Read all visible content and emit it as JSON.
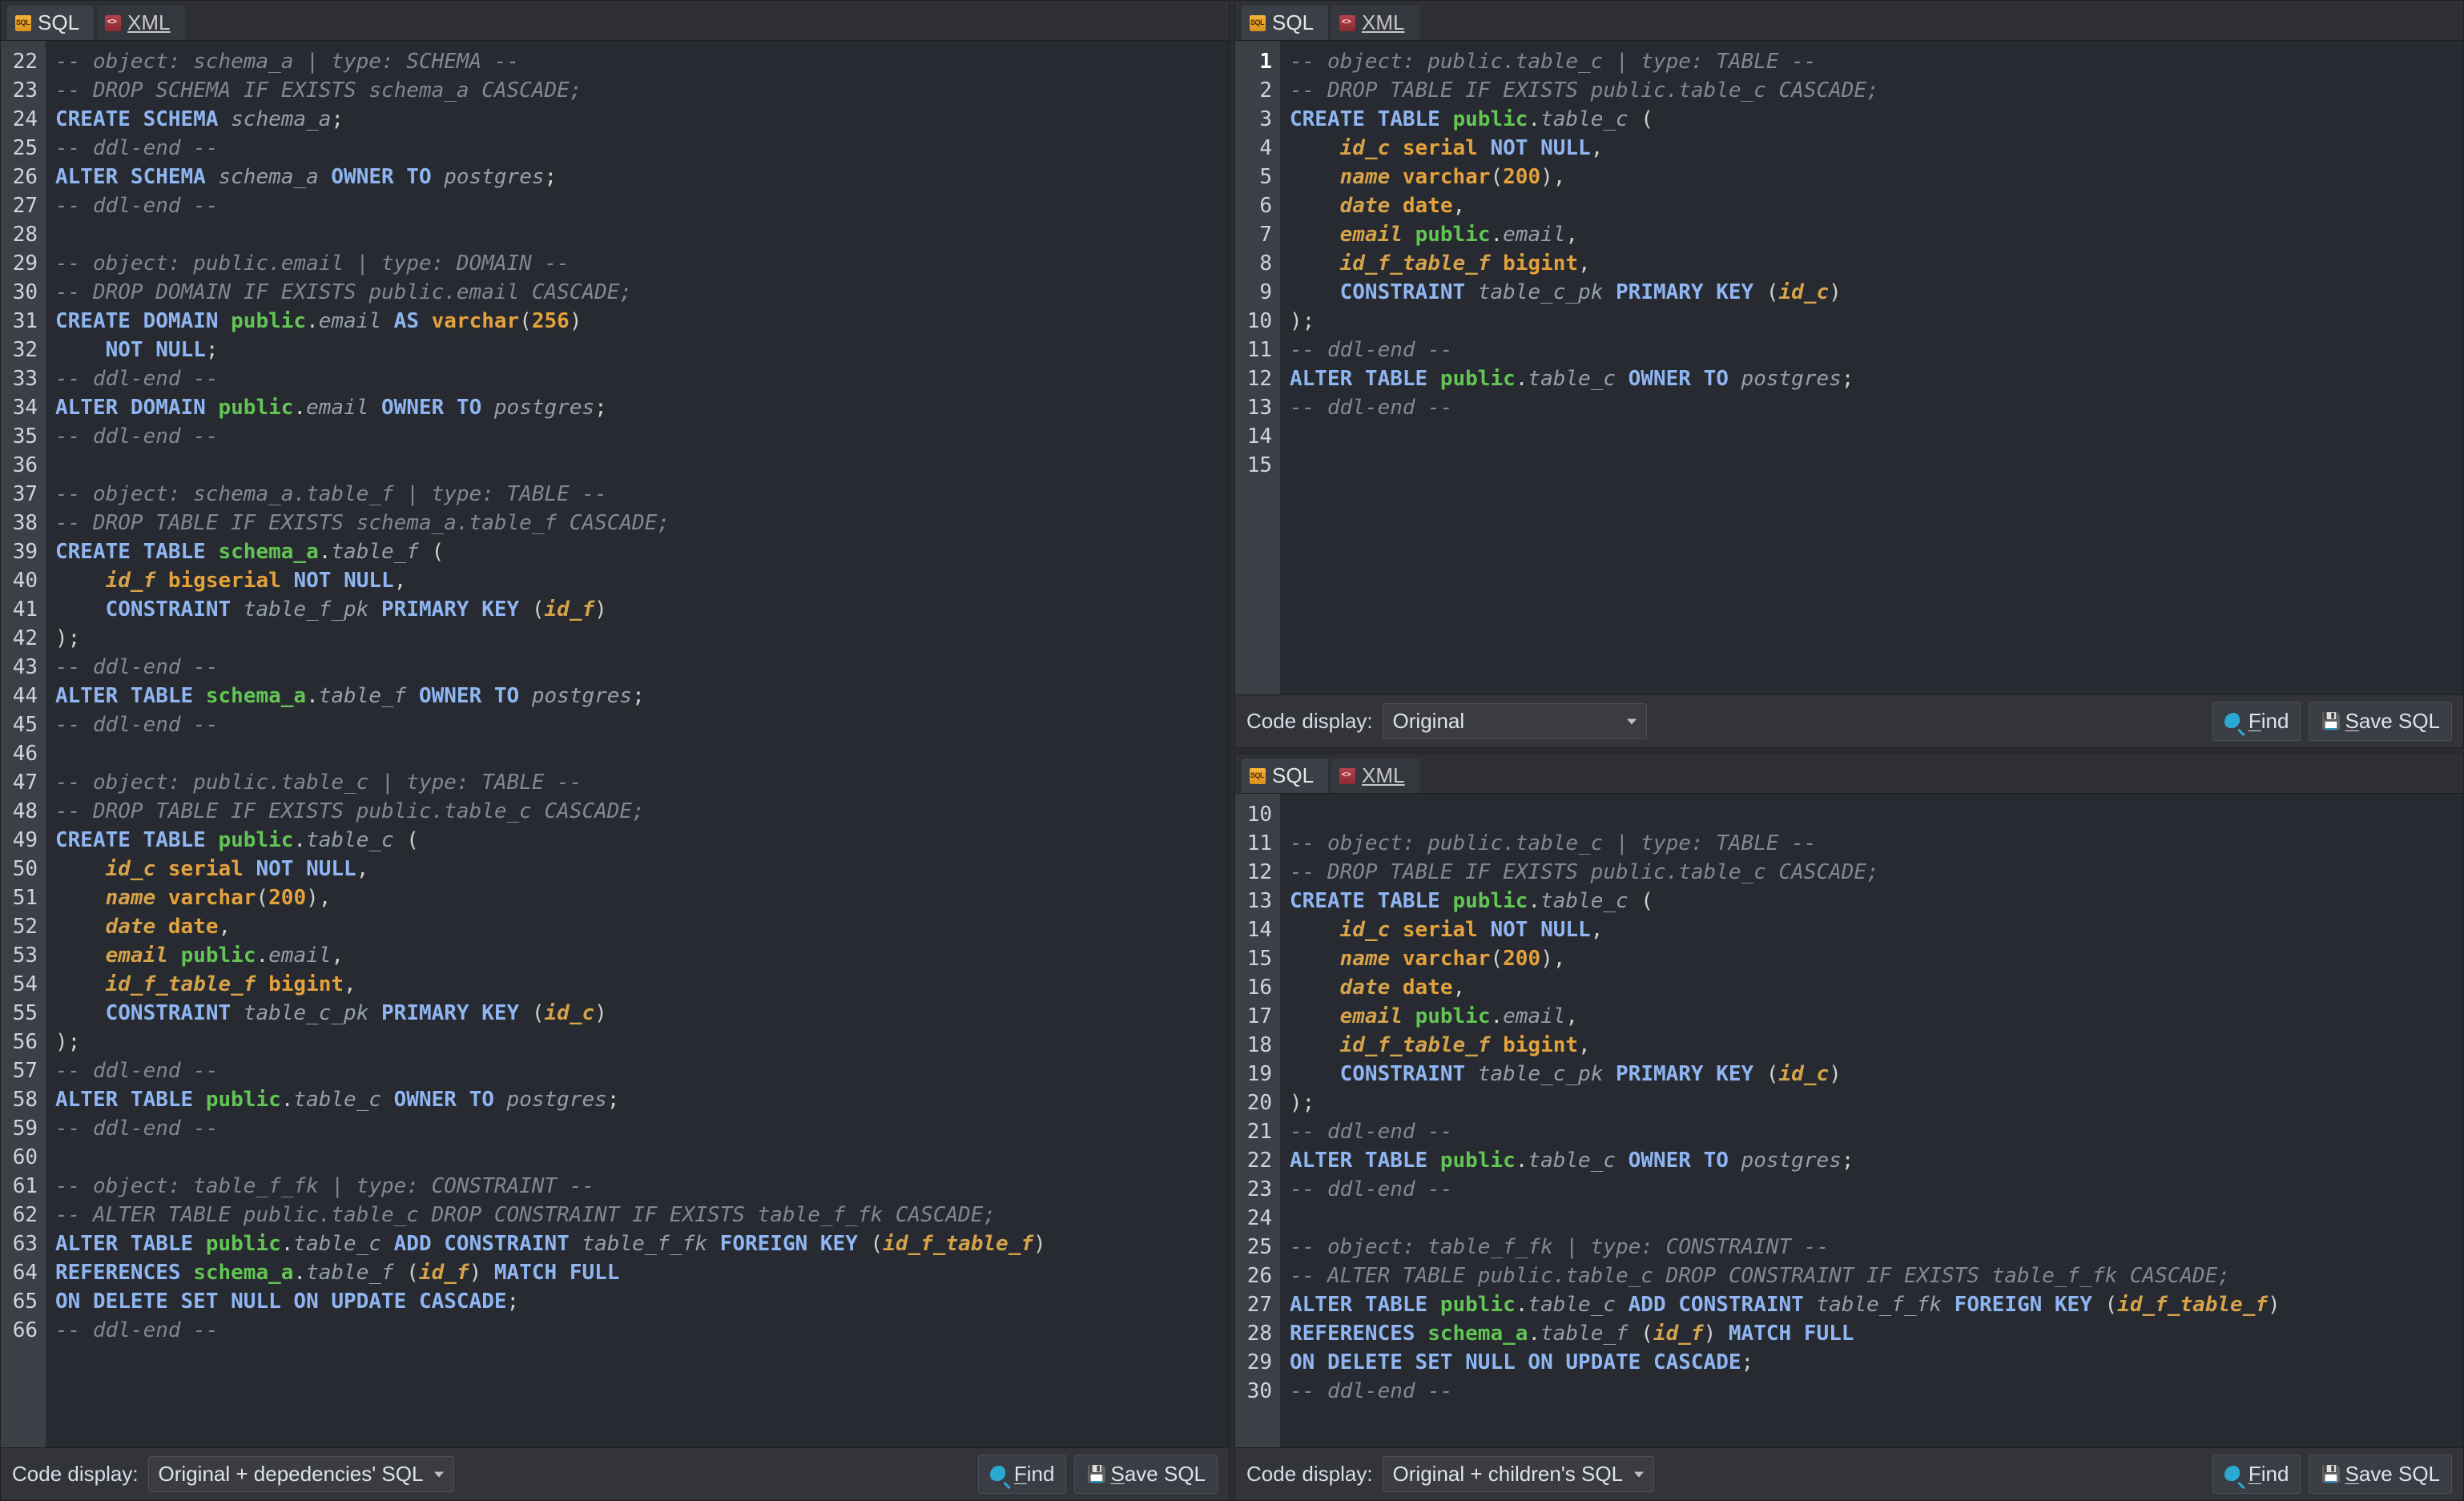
{
  "tabs": {
    "sql": "SQL",
    "xml": "XML"
  },
  "footer": {
    "label": "Code display:",
    "find": "Find",
    "save": "Save SQL",
    "find_u": "F",
    "save_u": "S"
  },
  "selects": {
    "p1": "Original",
    "p2": "Original + children's SQL",
    "p3": "Original + depedencies' SQL"
  },
  "p1": {
    "start": 1,
    "lines": [
      [
        [
          "cm",
          "-- object: public.table_c | type: TABLE --"
        ]
      ],
      [
        [
          "cm",
          "-- DROP TABLE IF EXISTS public.table_c CASCADE;"
        ]
      ],
      [
        [
          "kw",
          "CREATE TABLE "
        ],
        [
          "id-green",
          "public"
        ],
        [
          "par",
          "."
        ],
        [
          "id-ital",
          "table_c"
        ],
        [
          "par",
          " ("
        ]
      ],
      [
        [
          "par",
          "    "
        ],
        [
          "col",
          "id_c"
        ],
        [
          "par",
          " "
        ],
        [
          "typ",
          "serial"
        ],
        [
          "par",
          " "
        ],
        [
          "kw",
          "NOT NULL"
        ],
        [
          "par",
          ","
        ]
      ],
      [
        [
          "par",
          "    "
        ],
        [
          "col",
          "name"
        ],
        [
          "par",
          " "
        ],
        [
          "typ",
          "varchar"
        ],
        [
          "par",
          "("
        ],
        [
          "num",
          "200"
        ],
        [
          "par",
          "),"
        ]
      ],
      [
        [
          "par",
          "    "
        ],
        [
          "col",
          "date"
        ],
        [
          "par",
          " "
        ],
        [
          "typ",
          "date"
        ],
        [
          "par",
          ","
        ]
      ],
      [
        [
          "par",
          "    "
        ],
        [
          "col",
          "email"
        ],
        [
          "par",
          " "
        ],
        [
          "id-green",
          "public"
        ],
        [
          "par",
          "."
        ],
        [
          "id-ital",
          "email"
        ],
        [
          "par",
          ","
        ]
      ],
      [
        [
          "par",
          "    "
        ],
        [
          "col",
          "id_f_table_f"
        ],
        [
          "par",
          " "
        ],
        [
          "typ",
          "bigint"
        ],
        [
          "par",
          ","
        ]
      ],
      [
        [
          "par",
          "    "
        ],
        [
          "kw",
          "CONSTRAINT "
        ],
        [
          "id-ital",
          "table_c_pk"
        ],
        [
          "par",
          " "
        ],
        [
          "kw",
          "PRIMARY KEY"
        ],
        [
          "par",
          " ("
        ],
        [
          "col",
          "id_c"
        ],
        [
          "par",
          ")"
        ]
      ],
      [
        [
          "par",
          ");"
        ]
      ],
      [
        [
          "cm",
          "-- ddl-end --"
        ]
      ],
      [
        [
          "kw",
          "ALTER TABLE "
        ],
        [
          "id-green",
          "public"
        ],
        [
          "par",
          "."
        ],
        [
          "id-ital",
          "table_c"
        ],
        [
          "par",
          " "
        ],
        [
          "kw",
          "OWNER TO"
        ],
        [
          "par",
          " "
        ],
        [
          "id-ital",
          "postgres"
        ],
        [
          "par",
          ";"
        ]
      ],
      [
        [
          "cm",
          "-- ddl-end --"
        ]
      ],
      [
        [
          "par",
          ""
        ]
      ],
      [
        [
          "par",
          ""
        ]
      ]
    ]
  },
  "p2": {
    "start": 10,
    "lines": [
      [
        [
          "par",
          ""
        ]
      ],
      [
        [
          "cm",
          "-- object: public.table_c | type: TABLE --"
        ]
      ],
      [
        [
          "cm",
          "-- DROP TABLE IF EXISTS public.table_c CASCADE;"
        ]
      ],
      [
        [
          "kw",
          "CREATE TABLE "
        ],
        [
          "id-green",
          "public"
        ],
        [
          "par",
          "."
        ],
        [
          "id-ital",
          "table_c"
        ],
        [
          "par",
          " ("
        ]
      ],
      [
        [
          "par",
          "    "
        ],
        [
          "col",
          "id_c"
        ],
        [
          "par",
          " "
        ],
        [
          "typ",
          "serial"
        ],
        [
          "par",
          " "
        ],
        [
          "kw",
          "NOT NULL"
        ],
        [
          "par",
          ","
        ]
      ],
      [
        [
          "par",
          "    "
        ],
        [
          "col",
          "name"
        ],
        [
          "par",
          " "
        ],
        [
          "typ",
          "varchar"
        ],
        [
          "par",
          "("
        ],
        [
          "num",
          "200"
        ],
        [
          "par",
          "),"
        ]
      ],
      [
        [
          "par",
          "    "
        ],
        [
          "col",
          "date"
        ],
        [
          "par",
          " "
        ],
        [
          "typ",
          "date"
        ],
        [
          "par",
          ","
        ]
      ],
      [
        [
          "par",
          "    "
        ],
        [
          "col",
          "email"
        ],
        [
          "par",
          " "
        ],
        [
          "id-green",
          "public"
        ],
        [
          "par",
          "."
        ],
        [
          "id-ital",
          "email"
        ],
        [
          "par",
          ","
        ]
      ],
      [
        [
          "par",
          "    "
        ],
        [
          "col",
          "id_f_table_f"
        ],
        [
          "par",
          " "
        ],
        [
          "typ",
          "bigint"
        ],
        [
          "par",
          ","
        ]
      ],
      [
        [
          "par",
          "    "
        ],
        [
          "kw",
          "CONSTRAINT "
        ],
        [
          "id-ital",
          "table_c_pk"
        ],
        [
          "par",
          " "
        ],
        [
          "kw",
          "PRIMARY KEY"
        ],
        [
          "par",
          " ("
        ],
        [
          "col",
          "id_c"
        ],
        [
          "par",
          ")"
        ]
      ],
      [
        [
          "par",
          ");"
        ]
      ],
      [
        [
          "cm",
          "-- ddl-end --"
        ]
      ],
      [
        [
          "kw",
          "ALTER TABLE "
        ],
        [
          "id-green",
          "public"
        ],
        [
          "par",
          "."
        ],
        [
          "id-ital",
          "table_c"
        ],
        [
          "par",
          " "
        ],
        [
          "kw",
          "OWNER TO"
        ],
        [
          "par",
          " "
        ],
        [
          "id-ital",
          "postgres"
        ],
        [
          "par",
          ";"
        ]
      ],
      [
        [
          "cm",
          "-- ddl-end --"
        ]
      ],
      [
        [
          "par",
          ""
        ]
      ],
      [
        [
          "cm",
          "-- object: table_f_fk | type: CONSTRAINT --"
        ]
      ],
      [
        [
          "cm",
          "-- ALTER TABLE public.table_c DROP CONSTRAINT IF EXISTS table_f_fk CASCADE;"
        ]
      ],
      [
        [
          "kw",
          "ALTER TABLE "
        ],
        [
          "id-green",
          "public"
        ],
        [
          "par",
          "."
        ],
        [
          "id-ital",
          "table_c"
        ],
        [
          "par",
          " "
        ],
        [
          "kw",
          "ADD CONSTRAINT "
        ],
        [
          "id-ital",
          "table_f_fk"
        ],
        [
          "par",
          " "
        ],
        [
          "kw",
          "FOREIGN KEY"
        ],
        [
          "par",
          " ("
        ],
        [
          "col",
          "id_f_table_f"
        ],
        [
          "par",
          ")"
        ]
      ],
      [
        [
          "kw",
          "REFERENCES "
        ],
        [
          "id-green",
          "schema_a"
        ],
        [
          "par",
          "."
        ],
        [
          "id-ital",
          "table_f"
        ],
        [
          "par",
          " ("
        ],
        [
          "col",
          "id_f"
        ],
        [
          "par",
          ") "
        ],
        [
          "kw",
          "MATCH FULL"
        ]
      ],
      [
        [
          "kw",
          "ON DELETE SET NULL ON UPDATE CASCADE"
        ],
        [
          "par",
          ";"
        ]
      ],
      [
        [
          "cm",
          "-- ddl-end --"
        ]
      ]
    ]
  },
  "p3": {
    "start": 22,
    "lines": [
      [
        [
          "cm",
          "-- object: schema_a | type: SCHEMA --"
        ]
      ],
      [
        [
          "cm",
          "-- DROP SCHEMA IF EXISTS schema_a CASCADE;"
        ]
      ],
      [
        [
          "kw",
          "CREATE SCHEMA "
        ],
        [
          "id-ital",
          "schema_a"
        ],
        [
          "par",
          ";"
        ]
      ],
      [
        [
          "cm",
          "-- ddl-end --"
        ]
      ],
      [
        [
          "kw",
          "ALTER SCHEMA "
        ],
        [
          "id-ital",
          "schema_a"
        ],
        [
          "par",
          " "
        ],
        [
          "kw",
          "OWNER TO"
        ],
        [
          "par",
          " "
        ],
        [
          "id-ital",
          "postgres"
        ],
        [
          "par",
          ";"
        ]
      ],
      [
        [
          "cm",
          "-- ddl-end --"
        ]
      ],
      [
        [
          "par",
          ""
        ]
      ],
      [
        [
          "cm",
          "-- object: public.email | type: DOMAIN --"
        ]
      ],
      [
        [
          "cm",
          "-- DROP DOMAIN IF EXISTS public.email CASCADE;"
        ]
      ],
      [
        [
          "kw",
          "CREATE DOMAIN "
        ],
        [
          "id-green",
          "public"
        ],
        [
          "par",
          "."
        ],
        [
          "id-ital",
          "email"
        ],
        [
          "par",
          " "
        ],
        [
          "kw",
          "AS "
        ],
        [
          "typ",
          "varchar"
        ],
        [
          "par",
          "("
        ],
        [
          "num",
          "256"
        ],
        [
          "par",
          ")"
        ]
      ],
      [
        [
          "par",
          "    "
        ],
        [
          "kw",
          "NOT NULL"
        ],
        [
          "par",
          ";"
        ]
      ],
      [
        [
          "cm",
          "-- ddl-end --"
        ]
      ],
      [
        [
          "kw",
          "ALTER DOMAIN "
        ],
        [
          "id-green",
          "public"
        ],
        [
          "par",
          "."
        ],
        [
          "id-ital",
          "email"
        ],
        [
          "par",
          " "
        ],
        [
          "kw",
          "OWNER TO"
        ],
        [
          "par",
          " "
        ],
        [
          "id-ital",
          "postgres"
        ],
        [
          "par",
          ";"
        ]
      ],
      [
        [
          "cm",
          "-- ddl-end --"
        ]
      ],
      [
        [
          "par",
          ""
        ]
      ],
      [
        [
          "cm",
          "-- object: schema_a.table_f | type: TABLE --"
        ]
      ],
      [
        [
          "cm",
          "-- DROP TABLE IF EXISTS schema_a.table_f CASCADE;"
        ]
      ],
      [
        [
          "kw",
          "CREATE TABLE "
        ],
        [
          "id-green",
          "schema_a"
        ],
        [
          "par",
          "."
        ],
        [
          "id-ital",
          "table_f"
        ],
        [
          "par",
          " ("
        ]
      ],
      [
        [
          "par",
          "    "
        ],
        [
          "col",
          "id_f"
        ],
        [
          "par",
          " "
        ],
        [
          "typ",
          "bigserial"
        ],
        [
          "par",
          " "
        ],
        [
          "kw",
          "NOT NULL"
        ],
        [
          "par",
          ","
        ]
      ],
      [
        [
          "par",
          "    "
        ],
        [
          "kw",
          "CONSTRAINT "
        ],
        [
          "id-ital",
          "table_f_pk"
        ],
        [
          "par",
          " "
        ],
        [
          "kw",
          "PRIMARY KEY"
        ],
        [
          "par",
          " ("
        ],
        [
          "col",
          "id_f"
        ],
        [
          "par",
          ")"
        ]
      ],
      [
        [
          "par",
          ");"
        ]
      ],
      [
        [
          "cm",
          "-- ddl-end --"
        ]
      ],
      [
        [
          "kw",
          "ALTER TABLE "
        ],
        [
          "id-green",
          "schema_a"
        ],
        [
          "par",
          "."
        ],
        [
          "id-ital",
          "table_f"
        ],
        [
          "par",
          " "
        ],
        [
          "kw",
          "OWNER TO"
        ],
        [
          "par",
          " "
        ],
        [
          "id-ital",
          "postgres"
        ],
        [
          "par",
          ";"
        ]
      ],
      [
        [
          "cm",
          "-- ddl-end --"
        ]
      ],
      [
        [
          "par",
          ""
        ]
      ],
      [
        [
          "cm",
          "-- object: public.table_c | type: TABLE --"
        ]
      ],
      [
        [
          "cm",
          "-- DROP TABLE IF EXISTS public.table_c CASCADE;"
        ]
      ],
      [
        [
          "kw",
          "CREATE TABLE "
        ],
        [
          "id-green",
          "public"
        ],
        [
          "par",
          "."
        ],
        [
          "id-ital",
          "table_c"
        ],
        [
          "par",
          " ("
        ]
      ],
      [
        [
          "par",
          "    "
        ],
        [
          "col",
          "id_c"
        ],
        [
          "par",
          " "
        ],
        [
          "typ",
          "serial"
        ],
        [
          "par",
          " "
        ],
        [
          "kw",
          "NOT NULL"
        ],
        [
          "par",
          ","
        ]
      ],
      [
        [
          "par",
          "    "
        ],
        [
          "col",
          "name"
        ],
        [
          "par",
          " "
        ],
        [
          "typ",
          "varchar"
        ],
        [
          "par",
          "("
        ],
        [
          "num",
          "200"
        ],
        [
          "par",
          "),"
        ]
      ],
      [
        [
          "par",
          "    "
        ],
        [
          "col",
          "date"
        ],
        [
          "par",
          " "
        ],
        [
          "typ",
          "date"
        ],
        [
          "par",
          ","
        ]
      ],
      [
        [
          "par",
          "    "
        ],
        [
          "col",
          "email"
        ],
        [
          "par",
          " "
        ],
        [
          "id-green",
          "public"
        ],
        [
          "par",
          "."
        ],
        [
          "id-ital",
          "email"
        ],
        [
          "par",
          ","
        ]
      ],
      [
        [
          "par",
          "    "
        ],
        [
          "col",
          "id_f_table_f"
        ],
        [
          "par",
          " "
        ],
        [
          "typ",
          "bigint"
        ],
        [
          "par",
          ","
        ]
      ],
      [
        [
          "par",
          "    "
        ],
        [
          "kw",
          "CONSTRAINT "
        ],
        [
          "id-ital",
          "table_c_pk"
        ],
        [
          "par",
          " "
        ],
        [
          "kw",
          "PRIMARY KEY"
        ],
        [
          "par",
          " ("
        ],
        [
          "col",
          "id_c"
        ],
        [
          "par",
          ")"
        ]
      ],
      [
        [
          "par",
          ");"
        ]
      ],
      [
        [
          "cm",
          "-- ddl-end --"
        ]
      ],
      [
        [
          "kw",
          "ALTER TABLE "
        ],
        [
          "id-green",
          "public"
        ],
        [
          "par",
          "."
        ],
        [
          "id-ital",
          "table_c"
        ],
        [
          "par",
          " "
        ],
        [
          "kw",
          "OWNER TO"
        ],
        [
          "par",
          " "
        ],
        [
          "id-ital",
          "postgres"
        ],
        [
          "par",
          ";"
        ]
      ],
      [
        [
          "cm",
          "-- ddl-end --"
        ]
      ],
      [
        [
          "par",
          ""
        ]
      ],
      [
        [
          "cm",
          "-- object: table_f_fk | type: CONSTRAINT --"
        ]
      ],
      [
        [
          "cm",
          "-- ALTER TABLE public.table_c DROP CONSTRAINT IF EXISTS table_f_fk CASCADE;"
        ]
      ],
      [
        [
          "kw",
          "ALTER TABLE "
        ],
        [
          "id-green",
          "public"
        ],
        [
          "par",
          "."
        ],
        [
          "id-ital",
          "table_c"
        ],
        [
          "par",
          " "
        ],
        [
          "kw",
          "ADD CONSTRAINT "
        ],
        [
          "id-ital",
          "table_f_fk"
        ],
        [
          "par",
          " "
        ],
        [
          "kw",
          "FOREIGN KEY"
        ],
        [
          "par",
          " ("
        ],
        [
          "col",
          "id_f_table_f"
        ],
        [
          "par",
          ")"
        ]
      ],
      [
        [
          "kw",
          "REFERENCES "
        ],
        [
          "id-green",
          "schema_a"
        ],
        [
          "par",
          "."
        ],
        [
          "id-ital",
          "table_f"
        ],
        [
          "par",
          " ("
        ],
        [
          "col",
          "id_f"
        ],
        [
          "par",
          ") "
        ],
        [
          "kw",
          "MATCH FULL"
        ]
      ],
      [
        [
          "kw",
          "ON DELETE SET NULL ON UPDATE CASCADE"
        ],
        [
          "par",
          ";"
        ]
      ],
      [
        [
          "cm",
          "-- ddl-end --"
        ]
      ]
    ]
  }
}
